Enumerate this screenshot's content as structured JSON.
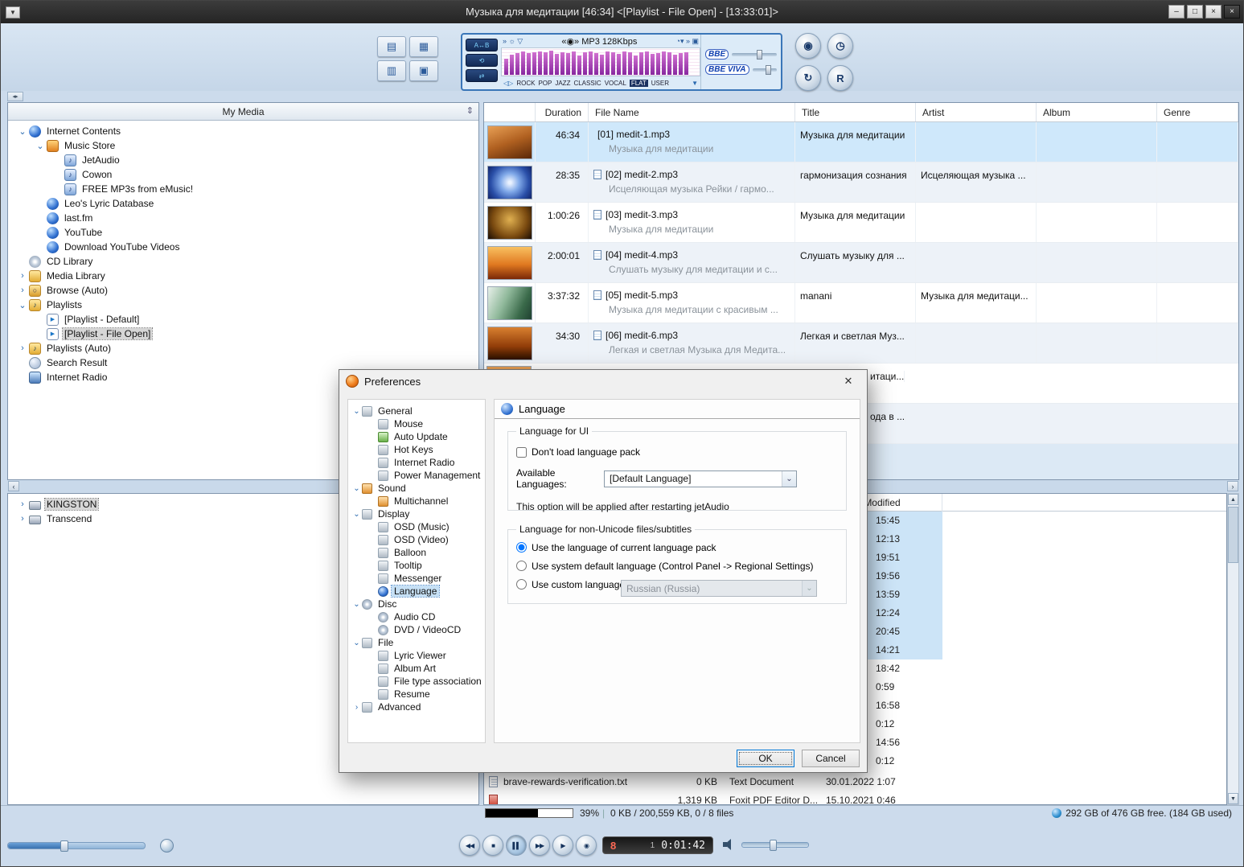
{
  "window": {
    "title": "Музыка для медитации  [46:34]    <[Playlist - File Open] - [13:33:01]>"
  },
  "icons": {
    "menu": "▼",
    "minimize": "–",
    "maximize": "□",
    "close": "×",
    "skin_close": "×",
    "collapse_handle": "◂▸",
    "hsplit_left": "‹",
    "hsplit_right": "›",
    "scroll_up": "▲",
    "scroll_down": "▼",
    "sort": "⇕",
    "broadcast": "«◉»",
    "eq_icons_left": "» ☼ ▽",
    "eq_icons_right": "◔▾ » ▣",
    "preset_arrows": "◁▷",
    "preset_dropdown": "▼",
    "dialog_close": "✕",
    "combo_chevron": "⌄"
  },
  "toolbar": {
    "left_buttons": [
      {
        "name": "playlist-window-button",
        "glyph": "▤"
      },
      {
        "name": "video-window-button",
        "glyph": "▦"
      },
      {
        "name": "visualization-window-button",
        "glyph": "▥"
      },
      {
        "name": "skin-mode-button",
        "glyph": "▣"
      }
    ],
    "right_buttons": [
      {
        "name": "sound-effect-button",
        "glyph": "◉"
      },
      {
        "name": "timer-button",
        "glyph": "◷"
      },
      {
        "name": "repeat-mode-button",
        "glyph": "↻"
      },
      {
        "name": "record-mode-button",
        "glyph": "R"
      }
    ],
    "eq": {
      "format": "MP3 128Kbps",
      "side_buttons": [
        {
          "name": "ab-repeat-button",
          "glyph": "A↔B"
        },
        {
          "name": "repeat-button",
          "glyph": "⟲"
        },
        {
          "name": "shuffle-button",
          "glyph": "⇄"
        }
      ],
      "presets": [
        {
          "label": "ROCK"
        },
        {
          "label": "POP"
        },
        {
          "label": "JAZZ"
        },
        {
          "label": "CLASSIC"
        },
        {
          "label": "VOCAL"
        },
        {
          "label": "FLAT",
          "active": true
        },
        {
          "label": "USER"
        }
      ],
      "bbe": "BBE",
      "bbe_viva": "BBE VIVA",
      "spectrum": [
        62,
        78,
        85,
        90,
        83,
        88,
        92,
        86,
        95,
        80,
        88,
        84,
        90,
        76,
        88,
        92,
        85,
        78,
        90,
        86,
        82,
        92,
        88,
        74,
        86,
        90,
        80,
        85,
        92,
        87,
        78,
        84,
        88
      ]
    }
  },
  "sidebar": {
    "header": "My Media",
    "tree": [
      {
        "label": "Internet Contents",
        "depth": 0,
        "expander": "⌄",
        "icon": "globe-icon"
      },
      {
        "label": "Music Store",
        "depth": 1,
        "expander": "⌄",
        "icon": "store-icon"
      },
      {
        "label": "JetAudio",
        "depth": 2,
        "expander": "",
        "icon": "music-note-icon"
      },
      {
        "label": "Cowon",
        "depth": 2,
        "expander": "",
        "icon": "music-note-icon"
      },
      {
        "label": "FREE MP3s from eMusic!",
        "depth": 2,
        "expander": "",
        "icon": "music-note-icon"
      },
      {
        "label": "Leo's Lyric Database",
        "depth": 1,
        "expander": "",
        "icon": "globe-icon"
      },
      {
        "label": "last.fm",
        "depth": 1,
        "expander": "",
        "icon": "globe-icon"
      },
      {
        "label": "YouTube",
        "depth": 1,
        "expander": "",
        "icon": "globe-icon"
      },
      {
        "label": "Download YouTube Videos",
        "depth": 1,
        "expander": "",
        "icon": "globe-icon"
      },
      {
        "label": "CD Library",
        "depth": 0,
        "expander": "",
        "icon": "cd-icon"
      },
      {
        "label": "Media Library",
        "depth": 0,
        "expander": "›",
        "icon": "folder-icon"
      },
      {
        "label": "Browse (Auto)",
        "depth": 0,
        "expander": "›",
        "icon": "folder-search-icon"
      },
      {
        "label": "Playlists",
        "depth": 0,
        "expander": "⌄",
        "icon": "playlist-folder-icon"
      },
      {
        "label": "[Playlist - Default]",
        "depth": 1,
        "expander": "",
        "icon": "playlist-file-icon"
      },
      {
        "label": "[Playlist - File Open]",
        "depth": 1,
        "expander": "",
        "icon": "playlist-file-icon",
        "selected": true
      },
      {
        "label": "Playlists (Auto)",
        "depth": 0,
        "expander": "›",
        "icon": "playlist-folder-icon"
      },
      {
        "label": "Search Result",
        "depth": 0,
        "expander": "",
        "icon": "search-icon"
      },
      {
        "label": "Internet Radio",
        "depth": 0,
        "expander": "",
        "icon": "radio-icon"
      }
    ],
    "devices": [
      {
        "label": "KINGSTON",
        "depth": 0,
        "expander": "›",
        "icon": "drive-icon",
        "selected": true
      },
      {
        "label": "Transcend",
        "depth": 0,
        "expander": "›",
        "icon": "drive-icon"
      }
    ]
  },
  "playlist": {
    "columns": [
      "Duration",
      "File Name",
      "Title",
      "Artist",
      "Album",
      "Genre"
    ],
    "rows": [
      {
        "duration": "46:34",
        "icon": "play-icon",
        "file": "[01] medit-1.mp3",
        "file2": "Музыка для медитации",
        "title": "Музыка для медитации",
        "artist": "",
        "thumb": "t1",
        "state": "sel"
      },
      {
        "duration": "28:35",
        "icon": "file-icon",
        "file": "[02] medit-2.mp3",
        "file2": "Исцеляющая музыка Рейки / гармо...",
        "title": "гармонизация сознания",
        "artist": "Исцеляющая музыка ...",
        "thumb": "t2",
        "state": "alt"
      },
      {
        "duration": "1:00:26",
        "icon": "file-icon",
        "file": "[03] medit-3.mp3",
        "file2": "Музыка для медитации",
        "title": "Музыка для медитации",
        "artist": "",
        "thumb": "t3",
        "state": "plain"
      },
      {
        "duration": "2:00:01",
        "icon": "file-icon",
        "file": "[04] medit-4.mp3",
        "file2": "Слушать музыку для медитации и с...",
        "title": "Слушать музыку для ...",
        "artist": "",
        "thumb": "t4",
        "state": "alt"
      },
      {
        "duration": "3:37:32",
        "icon": "file-icon",
        "file": "[05] medit-5.mp3",
        "file2": "Музыка для медитации с красивым ...",
        "title": "manani",
        "artist": "Музыка для медитаци...",
        "thumb": "t5",
        "state": "plain"
      },
      {
        "duration": "34:30",
        "icon": "file-icon",
        "file": "[06] medit-6.mp3",
        "file2": "Легкая и светлая Музыка для Медита...",
        "title": "Легкая и светлая Муз...",
        "artist": "",
        "thumb": "t6",
        "state": "alt"
      }
    ],
    "partial_rows": [
      {
        "fragment": "итаци...",
        "state": "plain",
        "thumb": "t7"
      },
      {
        "fragment": "ода в ...",
        "state": "alt",
        "thumb": ""
      }
    ]
  },
  "browser": {
    "modified_header": "Modified",
    "rows": [
      {
        "t": "15:45",
        "sel": true
      },
      {
        "t": "12:13",
        "sel": true
      },
      {
        "t": "19:51",
        "sel": true
      },
      {
        "t": "19:56",
        "sel": true
      },
      {
        "t": "13:59",
        "sel": true
      },
      {
        "t": "12:24",
        "sel": true
      },
      {
        "t": "20:45",
        "sel": true
      },
      {
        "t": "14:21",
        "sel": true
      },
      {
        "t": "18:42"
      },
      {
        "t": "0:59"
      },
      {
        "t": "16:58"
      },
      {
        "t": "0:12"
      },
      {
        "t": "14:56"
      },
      {
        "t": "0:12"
      }
    ],
    "files": [
      {
        "name": "brave-rewards-verification.txt",
        "size": "0 KB",
        "type": "Text Document",
        "modified": "30.01.2022 1:07"
      },
      {
        "name": "",
        "size": "1,319 KB",
        "type": "Foxit PDF Editor D...",
        "modified": "15.10.2021 0:46"
      }
    ]
  },
  "status": {
    "percent": "39%",
    "files_info": "0 KB / 200,559 KB,  0 / 8 files",
    "disk_info": "292 GB of 476 GB free. (184 GB used)"
  },
  "player": {
    "buttons": [
      {
        "name": "previous-button",
        "glyph": "◀◀"
      },
      {
        "name": "stop-button",
        "glyph": "■"
      },
      {
        "name": "pause-button",
        "glyph": "▌▌",
        "pressed": true
      },
      {
        "name": "next-button",
        "glyph": "▶▶"
      },
      {
        "name": "play-button",
        "glyph": "▶"
      },
      {
        "name": "record-button",
        "glyph": "◉"
      }
    ],
    "display": {
      "track": "8",
      "index": "1",
      "time": "0:01:42"
    }
  },
  "dialog": {
    "title": "Preferences",
    "tree": [
      {
        "label": "General",
        "depth": 0,
        "expander": "⌄",
        "icon": "gear-icon"
      },
      {
        "label": "Mouse",
        "depth": 1,
        "expander": "",
        "icon": "mouse-icon"
      },
      {
        "label": "Auto Update",
        "depth": 1,
        "expander": "",
        "icon": "update-icon"
      },
      {
        "label": "Hot Keys",
        "depth": 1,
        "expander": "",
        "icon": "hotkeys-icon"
      },
      {
        "label": "Internet Radio",
        "depth": 1,
        "expander": "",
        "icon": "radio-icon"
      },
      {
        "label": "Power Management",
        "depth": 1,
        "expander": "",
        "icon": "power-icon"
      },
      {
        "label": "Sound",
        "depth": 0,
        "expander": "⌄",
        "icon": "sound-icon"
      },
      {
        "label": "Multichannel",
        "depth": 1,
        "expander": "",
        "icon": "multichannel-icon"
      },
      {
        "label": "Display",
        "depth": 0,
        "expander": "⌄",
        "icon": "display-icon"
      },
      {
        "label": "OSD (Music)",
        "depth": 1,
        "expander": "",
        "icon": "osd-icon"
      },
      {
        "label": "OSD (Video)",
        "depth": 1,
        "expander": "",
        "icon": "osd-icon"
      },
      {
        "label": "Balloon",
        "depth": 1,
        "expander": "",
        "icon": "balloon-icon"
      },
      {
        "label": "Tooltip",
        "depth": 1,
        "expander": "",
        "icon": "tooltip-icon"
      },
      {
        "label": "Messenger",
        "depth": 1,
        "expander": "",
        "icon": "messenger-icon"
      },
      {
        "label": "Language",
        "depth": 1,
        "expander": "",
        "icon": "language-icon",
        "selected": true
      },
      {
        "label": "Disc",
        "depth": 0,
        "expander": "⌄",
        "icon": "disc-icon"
      },
      {
        "label": "Audio CD",
        "depth": 1,
        "expander": "",
        "icon": "cd-icon"
      },
      {
        "label": "DVD / VideoCD",
        "depth": 1,
        "expander": "",
        "icon": "dvd-icon"
      },
      {
        "label": "File",
        "depth": 0,
        "expander": "⌄",
        "icon": "file-icon"
      },
      {
        "label": "Lyric Viewer",
        "depth": 1,
        "expander": "",
        "icon": "lyric-icon"
      },
      {
        "label": "Album Art",
        "depth": 1,
        "expander": "",
        "icon": "album-art-icon"
      },
      {
        "label": "File type association",
        "depth": 1,
        "expander": "",
        "icon": "association-icon"
      },
      {
        "label": "Resume",
        "depth": 1,
        "expander": "",
        "icon": "resume-icon"
      },
      {
        "label": "Advanced",
        "depth": 0,
        "expander": "›",
        "icon": "advanced-icon"
      }
    ],
    "panel": {
      "header": "Language",
      "group_ui": {
        "legend": "Language for UI",
        "checkbox_label": "Don't load language pack",
        "checkbox_checked": false,
        "available_label": "Available Languages:",
        "available_value": "[Default Language]",
        "note": "This option will be applied after restarting jetAudio"
      },
      "group_nonunicode": {
        "legend": "Language for non-Unicode files/subtitles",
        "options": [
          {
            "label": "Use the language of current language pack",
            "selected": true
          },
          {
            "label": "Use system default language (Control Panel -> Regional Settings)",
            "selected": false
          },
          {
            "label": "Use custom language:",
            "selected": false
          }
        ],
        "custom_value": "Russian (Russia)"
      },
      "ok": "OK",
      "cancel": "Cancel"
    }
  }
}
